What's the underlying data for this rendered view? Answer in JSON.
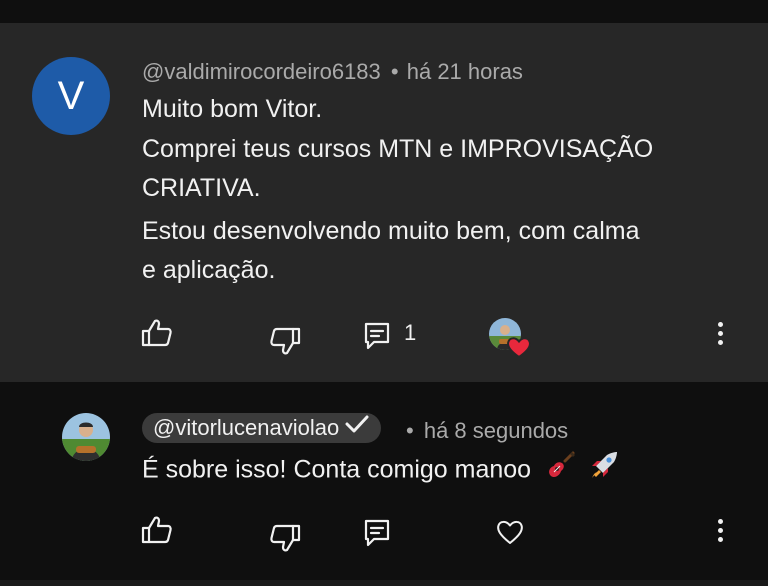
{
  "comment": {
    "avatar_letter": "V",
    "author": "@valdimirocordeiro6183",
    "separator": "•",
    "time": "há 21 horas",
    "lines": [
      "Muito bom Vitor.",
      "Comprei teus cursos MTN e IMPROVISAÇÃO",
      "CRIATIVA.",
      "Estou desenvolvendo muito bem, com calma",
      "e aplicação."
    ],
    "reply_count": "1",
    "icons": {
      "like": "thumbs-up-icon",
      "dislike": "thumbs-down-icon",
      "reply": "reply-icon",
      "creator_heart": "creator-heart-icon",
      "more": "more-vertical-icon"
    }
  },
  "reply": {
    "author": "@vitorlucenaviolao",
    "verified_icon": "checkmark-icon",
    "separator": "•",
    "time": "há 8 segundos",
    "text": "É sobre isso! Conta comigo manoo",
    "emojis": [
      "guitar-emoji",
      "rocket-emoji"
    ],
    "icons": {
      "like": "thumbs-up-icon",
      "dislike": "thumbs-down-icon",
      "reply": "reply-icon",
      "heart": "heart-icon",
      "more": "more-vertical-icon"
    }
  },
  "colors": {
    "comment_bg": "#272727",
    "page_bg": "#0f0f0f",
    "avatar_blue": "#1e5ba8",
    "heart_red": "#e8283c",
    "meta_gray": "#aaaaaa"
  }
}
